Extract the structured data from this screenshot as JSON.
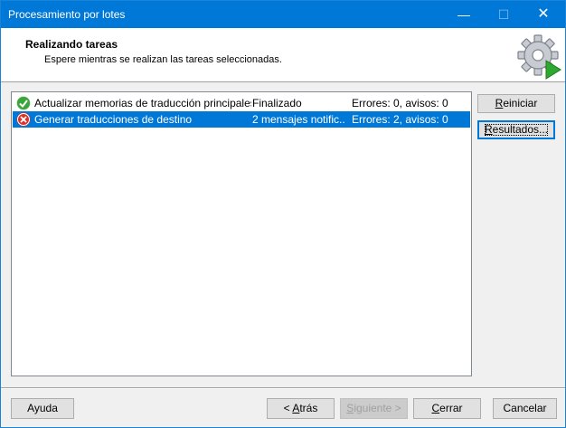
{
  "window": {
    "title": "Procesamiento por lotes",
    "controls": {
      "minimize": "—",
      "maximize": "☐",
      "close": "✕"
    }
  },
  "header": {
    "title": "Realizando tareas",
    "subtitle": "Espere mientras se realizan las tareas seleccionadas.",
    "icon": "gear-play-icon"
  },
  "tasks": [
    {
      "icon": "success-check-icon",
      "name": "Actualizar memorias de traducción principales",
      "status": "Finalizado",
      "result": "Errores: 0, avisos: 0",
      "selected": false
    },
    {
      "icon": "error-x-icon",
      "name": "Generar traducciones de destino",
      "status": "2 mensajes notific...",
      "result": "Errores: 2, avisos: 0",
      "selected": true
    }
  ],
  "side_buttons": {
    "reiniciar": {
      "pre": "",
      "key": "R",
      "post": "einiciar"
    },
    "resultados": {
      "pre": "",
      "key": "R",
      "post": "esultados..."
    }
  },
  "footer": {
    "help": "Ayuda",
    "back": {
      "pre": "< ",
      "key": "A",
      "post": "trás"
    },
    "next": {
      "pre": "",
      "key": "S",
      "post": "iguiente >"
    },
    "close": {
      "pre": "",
      "key": "C",
      "post": "errar"
    },
    "cancel": "Cancelar"
  },
  "colors": {
    "accent": "#0078d7",
    "success": "#3aa53a",
    "error": "#d9342b"
  }
}
